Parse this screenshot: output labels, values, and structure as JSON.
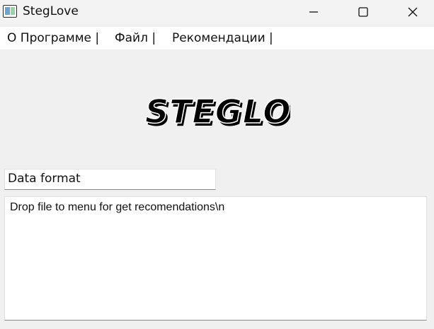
{
  "window": {
    "title": "StegLove",
    "icon": "app-window-icon",
    "controls": {
      "minimize_icon": "minimize-icon",
      "maximize_icon": "maximize-icon",
      "close_icon": "close-icon"
    }
  },
  "menu": {
    "items": [
      {
        "label": "О Программе |"
      },
      {
        "label": "Файл |"
      },
      {
        "label": "Рекомендации |"
      }
    ]
  },
  "logo": {
    "text": "STEGLOVE"
  },
  "format_field": {
    "value": "Data format"
  },
  "text_area": {
    "value": "Drop file to menu for get recomendations\\n"
  },
  "colors": {
    "background": "#f0f0f0",
    "titlebar": "#f3f3f3",
    "menubar": "#ffffff",
    "logo_fill": "#000000",
    "logo_shadow": "#ffffff"
  }
}
